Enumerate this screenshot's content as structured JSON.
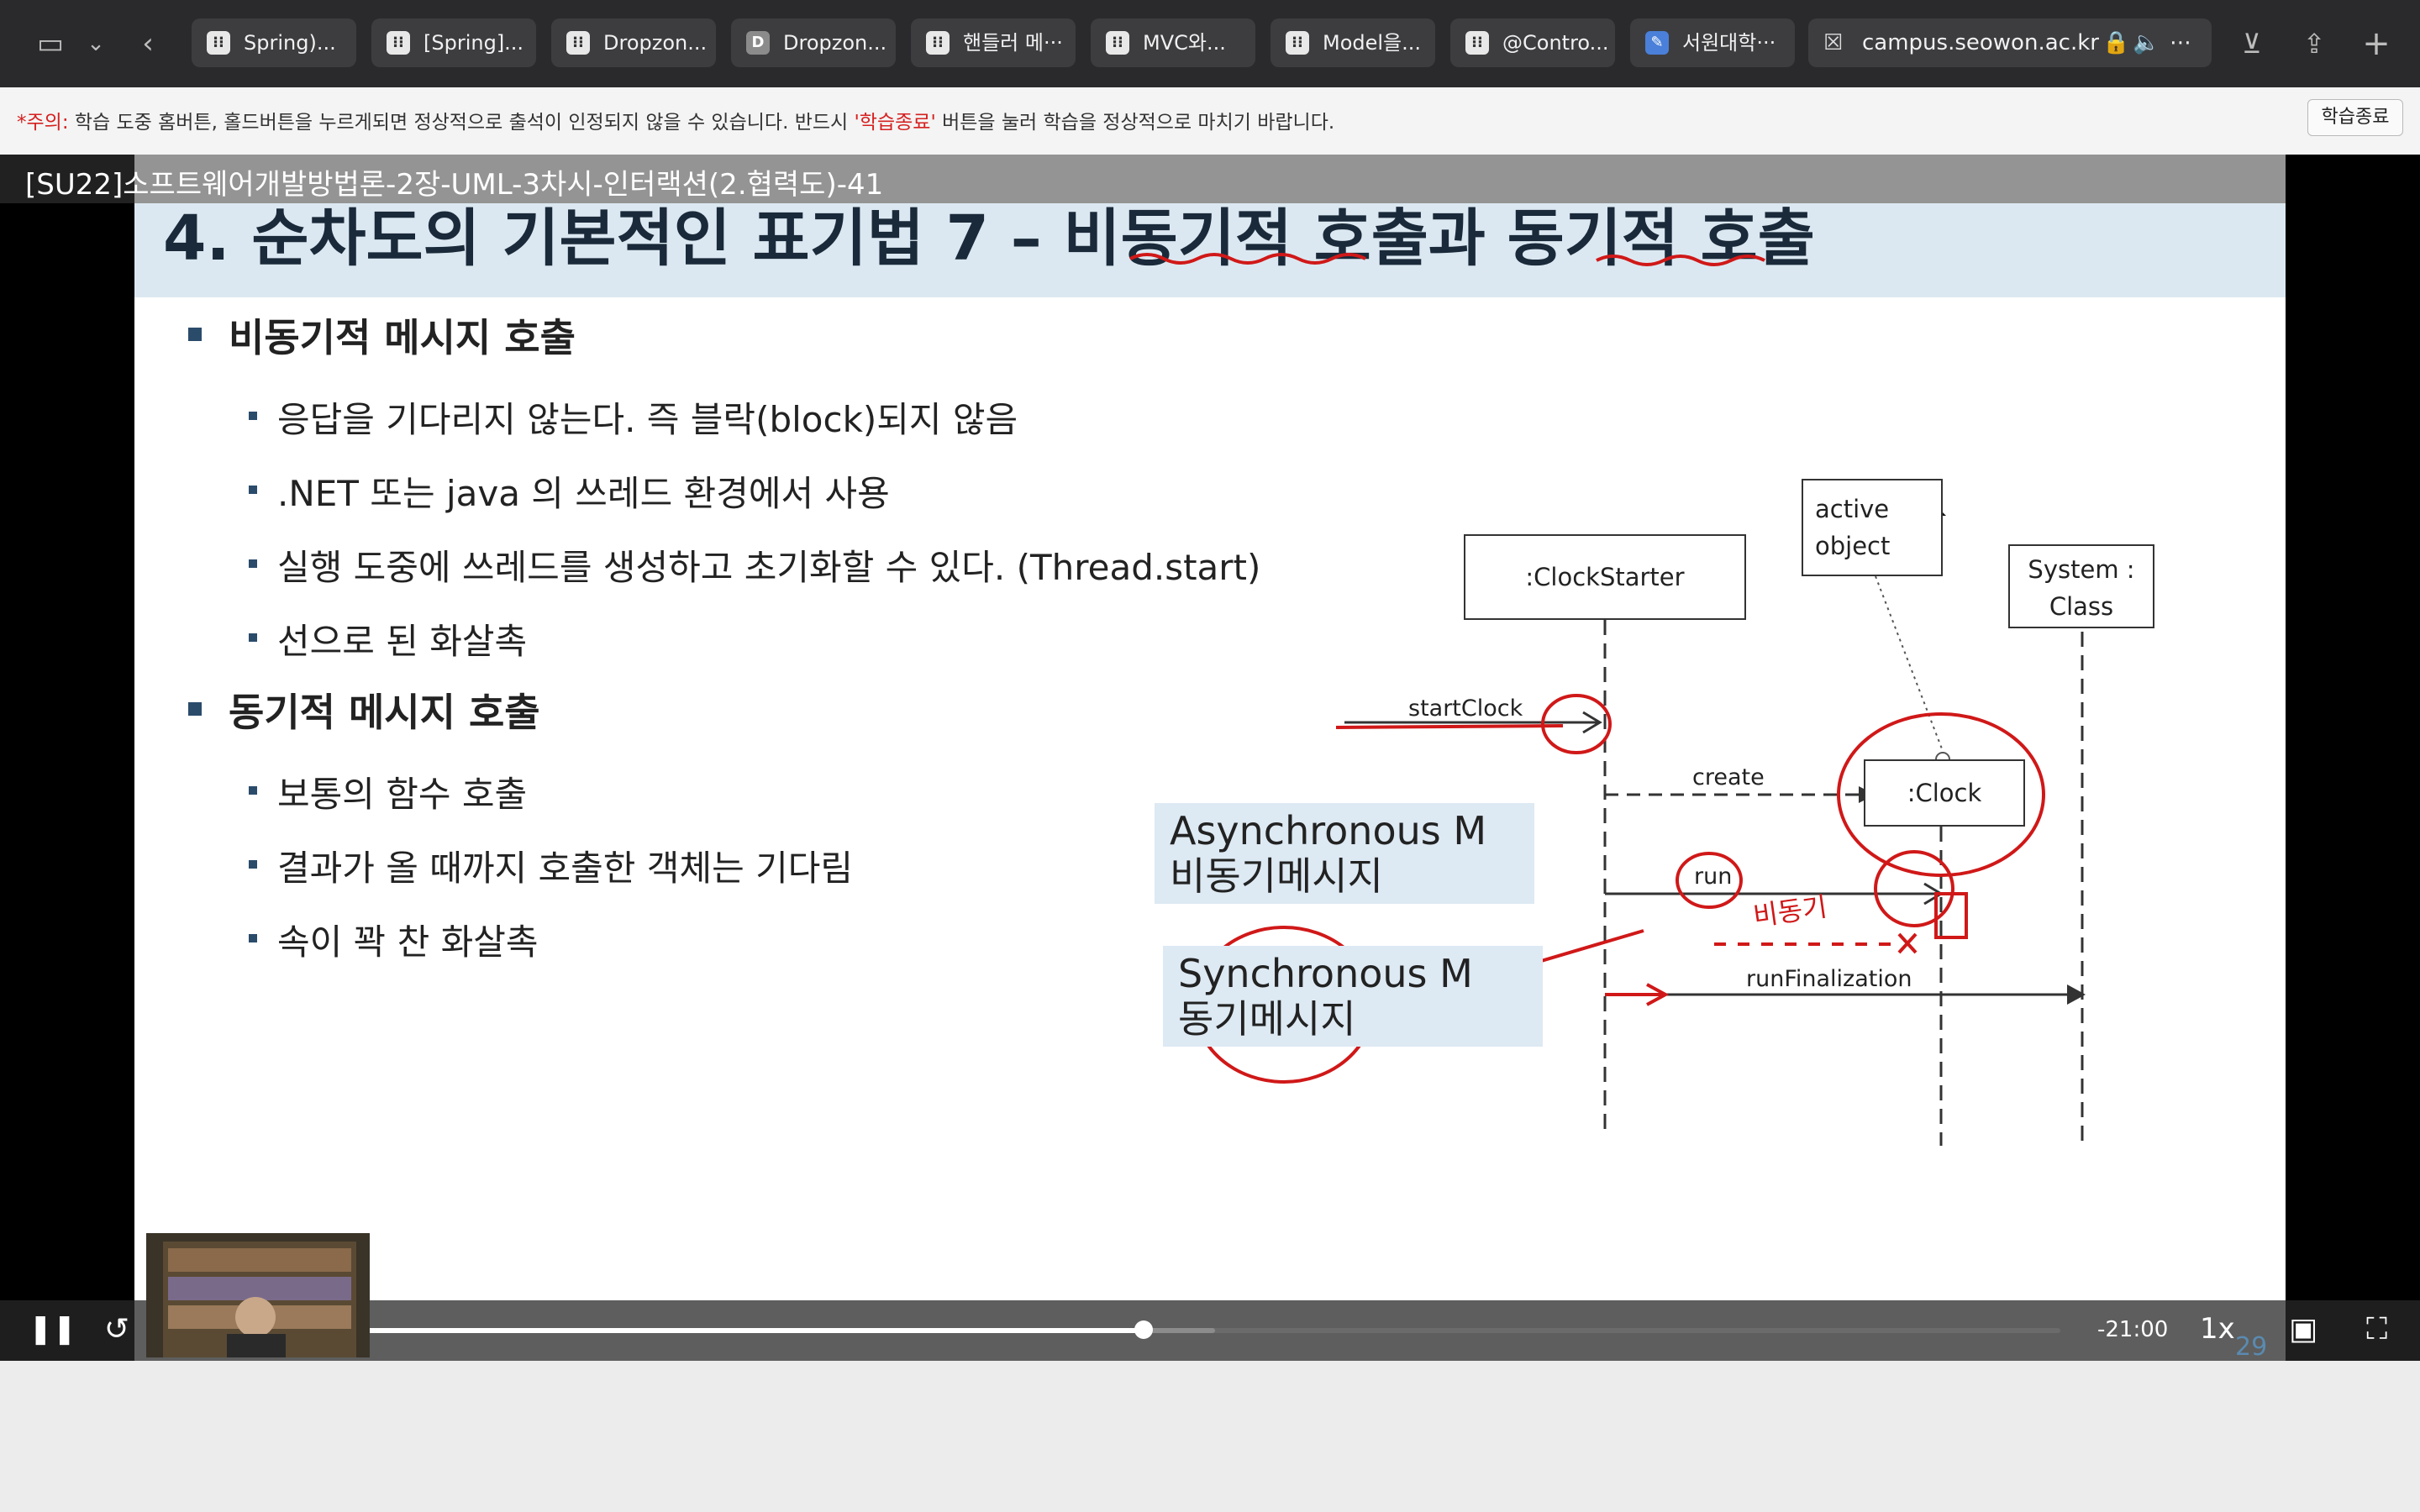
{
  "browser": {
    "tabs": [
      {
        "label": "Spring)...",
        "icon": "grid-favicon-icon"
      },
      {
        "label": "[Spring]...",
        "icon": "grid-favicon-icon"
      },
      {
        "label": "Dropzon...",
        "icon": "grid-favicon-icon"
      },
      {
        "label": "Dropzon...",
        "icon": "d-favicon-icon"
      },
      {
        "label": "핸들러 메···",
        "icon": "grid-favicon-icon"
      },
      {
        "label": "MVC와...",
        "icon": "grid-favicon-icon"
      },
      {
        "label": "Model을...",
        "icon": "grid-favicon-icon"
      },
      {
        "label": "@Contro...",
        "icon": "grid-favicon-icon"
      },
      {
        "label": "서원대학···",
        "icon": "doc-favicon-icon"
      }
    ],
    "url": "campus.seowon.ac.kr"
  },
  "notice": {
    "prefix": "*주의:",
    "text_before": " 학습 도중 홈버튼, 홀드버튼을 누르게되면 정상적으로 출석이 인정되지 않을 수 있습니다. 반드시 ",
    "highlight": "'학습종료'",
    "text_after": " 버튼을 눌러 학습을 정상적으로 마치기 바랍니다.",
    "end_button": "학습종료"
  },
  "video": {
    "title": "[SU22]소프트웨어개발방법론-2장-UML-3차시-인터랙션(2.협력도)-41",
    "remaining_time": "-21:00",
    "speed": "1x",
    "progress_fraction": 0.49,
    "buffered_fraction": 0.53,
    "page_number": "29"
  },
  "slide": {
    "title": "4. 순차도의 기본적인 표기법 7 – 비동기적 호출과 동기적 호출",
    "sections": [
      {
        "heading": "비동기적 메시지 호출",
        "items": [
          "응답을 기다리지 않는다. 즉 블락(block)되지 않음",
          ".NET 또는 java 의 쓰레드 환경에서 사용",
          "실행 도중에 쓰레드를 생성하고 초기화할 수 있다. (Thread.start)",
          "선으로 된 화살촉"
        ]
      },
      {
        "heading": "동기적 메시지 호출",
        "items": [
          "보통의 함수 호출",
          "결과가 올 때까지 호출한 객체는 기다림",
          "속이 꽉 찬 화살촉"
        ]
      }
    ],
    "diagram": {
      "clock_starter": ":ClockStarter",
      "active_note": [
        "active",
        "object"
      ],
      "system_class": [
        "System  :",
        "Class"
      ],
      "clock": ":Clock",
      "msg_start": "startClock",
      "msg_create": "create",
      "msg_run": "run",
      "msg_final": "runFinalization",
      "async_callout": [
        "Asynchronous M",
        "비동기메시지"
      ],
      "sync_callout": [
        "Synchronous M",
        "동기메시지"
      ],
      "handwritten": "비동기"
    }
  },
  "colors": {
    "annotation": "#d01818",
    "callout_bg": "#dde9f3",
    "title_band": "#dce8f1"
  }
}
